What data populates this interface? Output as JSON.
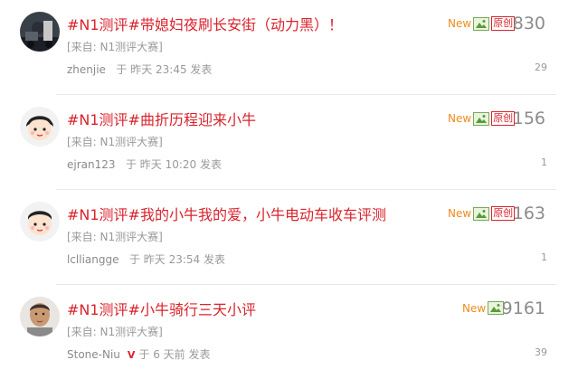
{
  "posts": [
    {
      "title": "#N1测评#带媳妇夜刷长安街（动力黑）！",
      "source": "[来自: N1测评大赛]",
      "author": "zhenjie",
      "time": "于 昨天 23:45 发表",
      "new_label": "New",
      "original_label": "原创",
      "views": "830",
      "replies": "29",
      "avatar_icon": "photo-avatar-icon",
      "has_original": true,
      "vip": ""
    },
    {
      "title": "#N1测评#曲折历程迎来小牛",
      "source": "[来自: N1测评大赛]",
      "author": "ejran123",
      "time": "于 昨天 10:20 发表",
      "new_label": "New",
      "original_label": "原创",
      "views": "156",
      "replies": "1",
      "avatar_icon": "cartoon-avatar-icon",
      "has_original": true,
      "vip": ""
    },
    {
      "title": "#N1测评#我的小牛我的爱，小牛电动车收车评测",
      "source": "[来自: N1测评大赛]",
      "author": "lclliangge",
      "time": "于 昨天 23:54 发表",
      "new_label": "New",
      "original_label": "原创",
      "views": "163",
      "replies": "1",
      "avatar_icon": "cartoon-avatar-icon",
      "has_original": true,
      "vip": ""
    },
    {
      "title": "#N1测评#小牛骑行三天小评",
      "source": "[来自: N1测评大赛]",
      "author": "Stone-Niu",
      "time": "于 6 天前 发表",
      "new_label": "New",
      "original_label": "",
      "views": "9161",
      "replies": "39",
      "avatar_icon": "face-photo-avatar-icon",
      "has_original": false,
      "vip": "V"
    }
  ]
}
